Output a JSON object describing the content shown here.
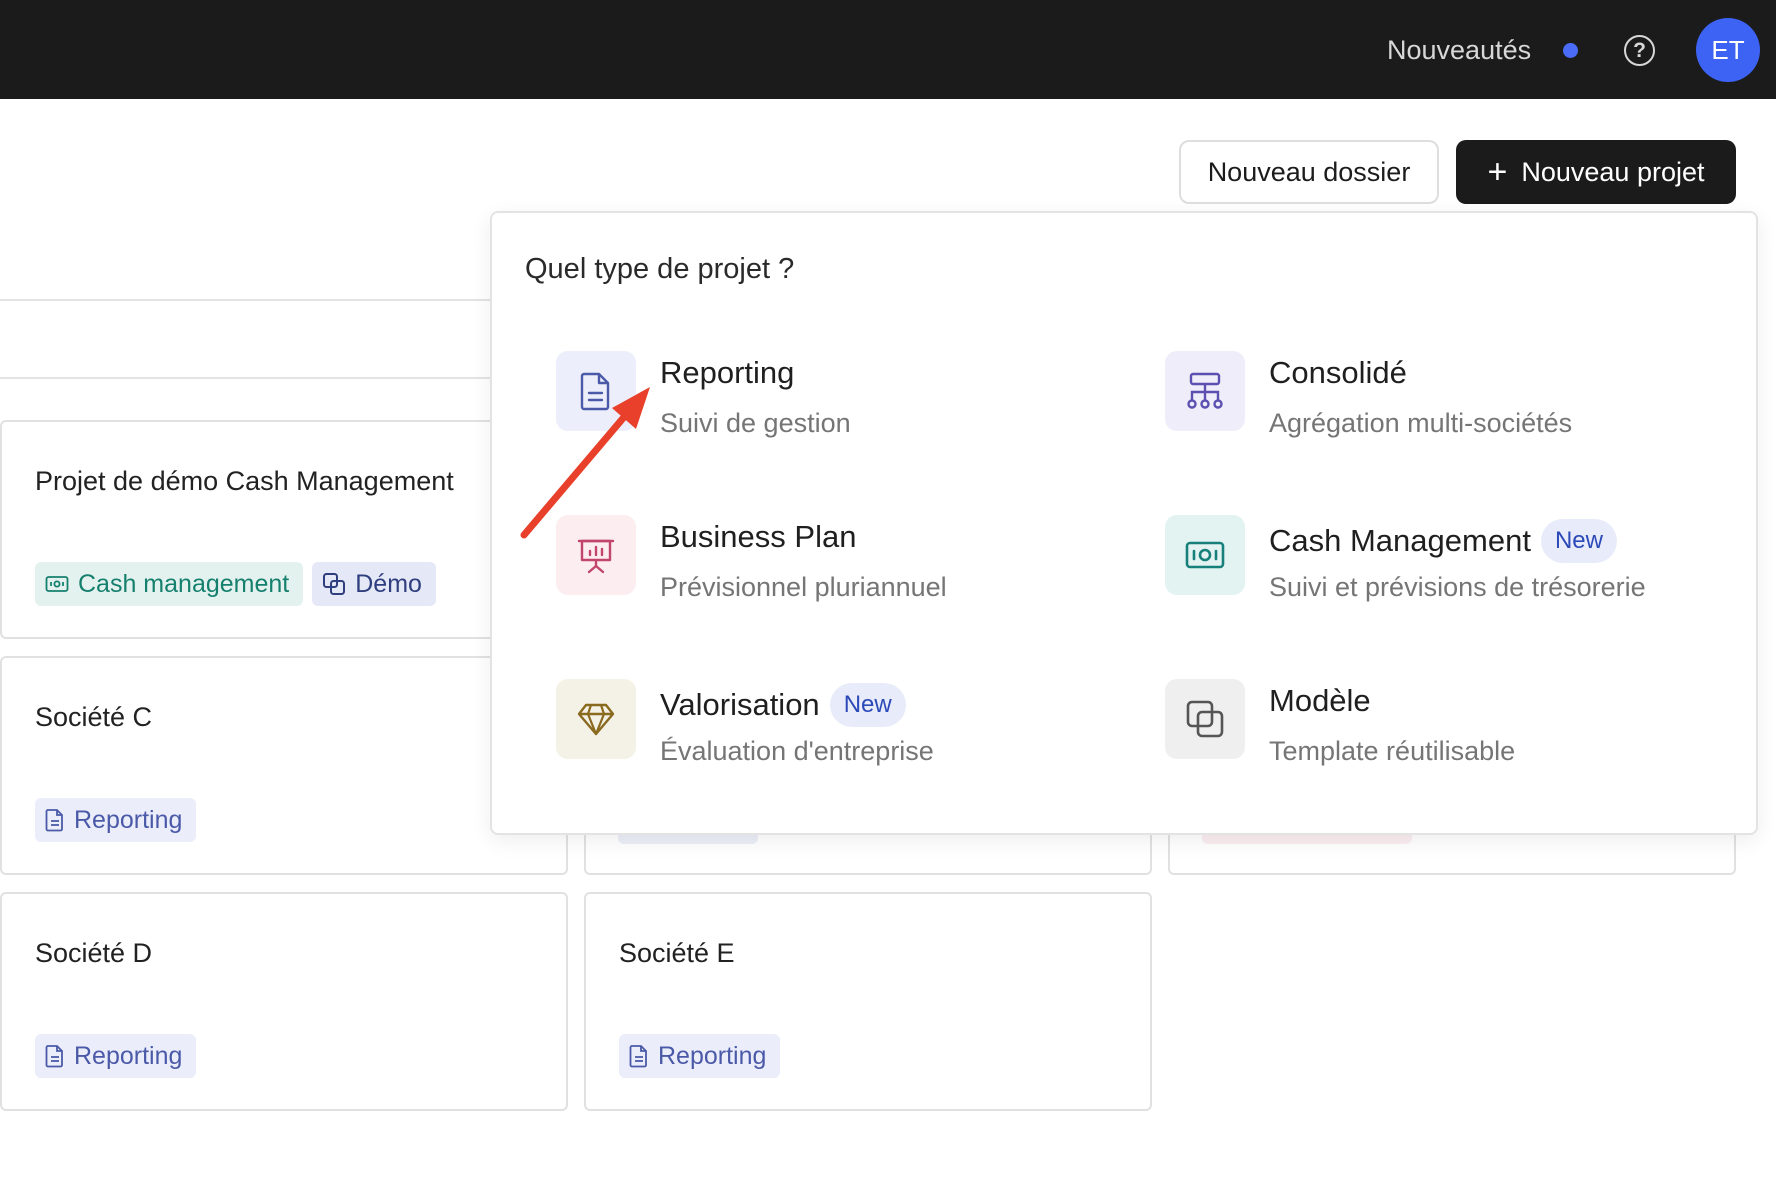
{
  "header": {
    "news_label": "Nouveautés",
    "help_icon": "question-circle-icon",
    "avatar_initials": "ET"
  },
  "actions": {
    "new_folder": "Nouveau dossier",
    "new_project": "Nouveau projet"
  },
  "dropdown": {
    "title": "Quel type de projet ?",
    "options": [
      {
        "title": "Reporting",
        "subtitle": "Suivi de gestion",
        "icon": "document-icon",
        "color": "#4b5aa8"
      },
      {
        "title": "Consolidé",
        "subtitle": "Agrégation multi-sociétés",
        "icon": "hierarchy-icon",
        "color": "#5b4fb0"
      },
      {
        "title": "Business Plan",
        "subtitle": "Prévisionnel pluriannuel",
        "icon": "presentation-icon",
        "color": "#c2456e"
      },
      {
        "title": "Cash Management",
        "badge": "New",
        "subtitle": "Suivi et prévisions de trésorerie",
        "icon": "banknote-icon",
        "color": "#17807a"
      },
      {
        "title": "Valorisation",
        "badge": "New",
        "subtitle": "Évaluation d'entreprise",
        "icon": "diamond-icon",
        "color": "#8a6a1e"
      },
      {
        "title": "Modèle",
        "subtitle": "Template réutilisable",
        "icon": "copy-icon",
        "color": "#555555"
      }
    ]
  },
  "cards": [
    {
      "title": "Projet de démo Cash Management",
      "tags": [
        "Cash management",
        "Démo"
      ]
    },
    {
      "title": "Société C",
      "tags": [
        "Reporting"
      ]
    },
    {
      "title": "Société D",
      "tags": [
        "Reporting"
      ]
    },
    {
      "title": "Société E",
      "tags": [
        "Reporting"
      ]
    }
  ],
  "colors": {
    "topbar": "#1b1b1c",
    "accent": "#3d63f5",
    "annotation_arrow": "#e8402a"
  }
}
